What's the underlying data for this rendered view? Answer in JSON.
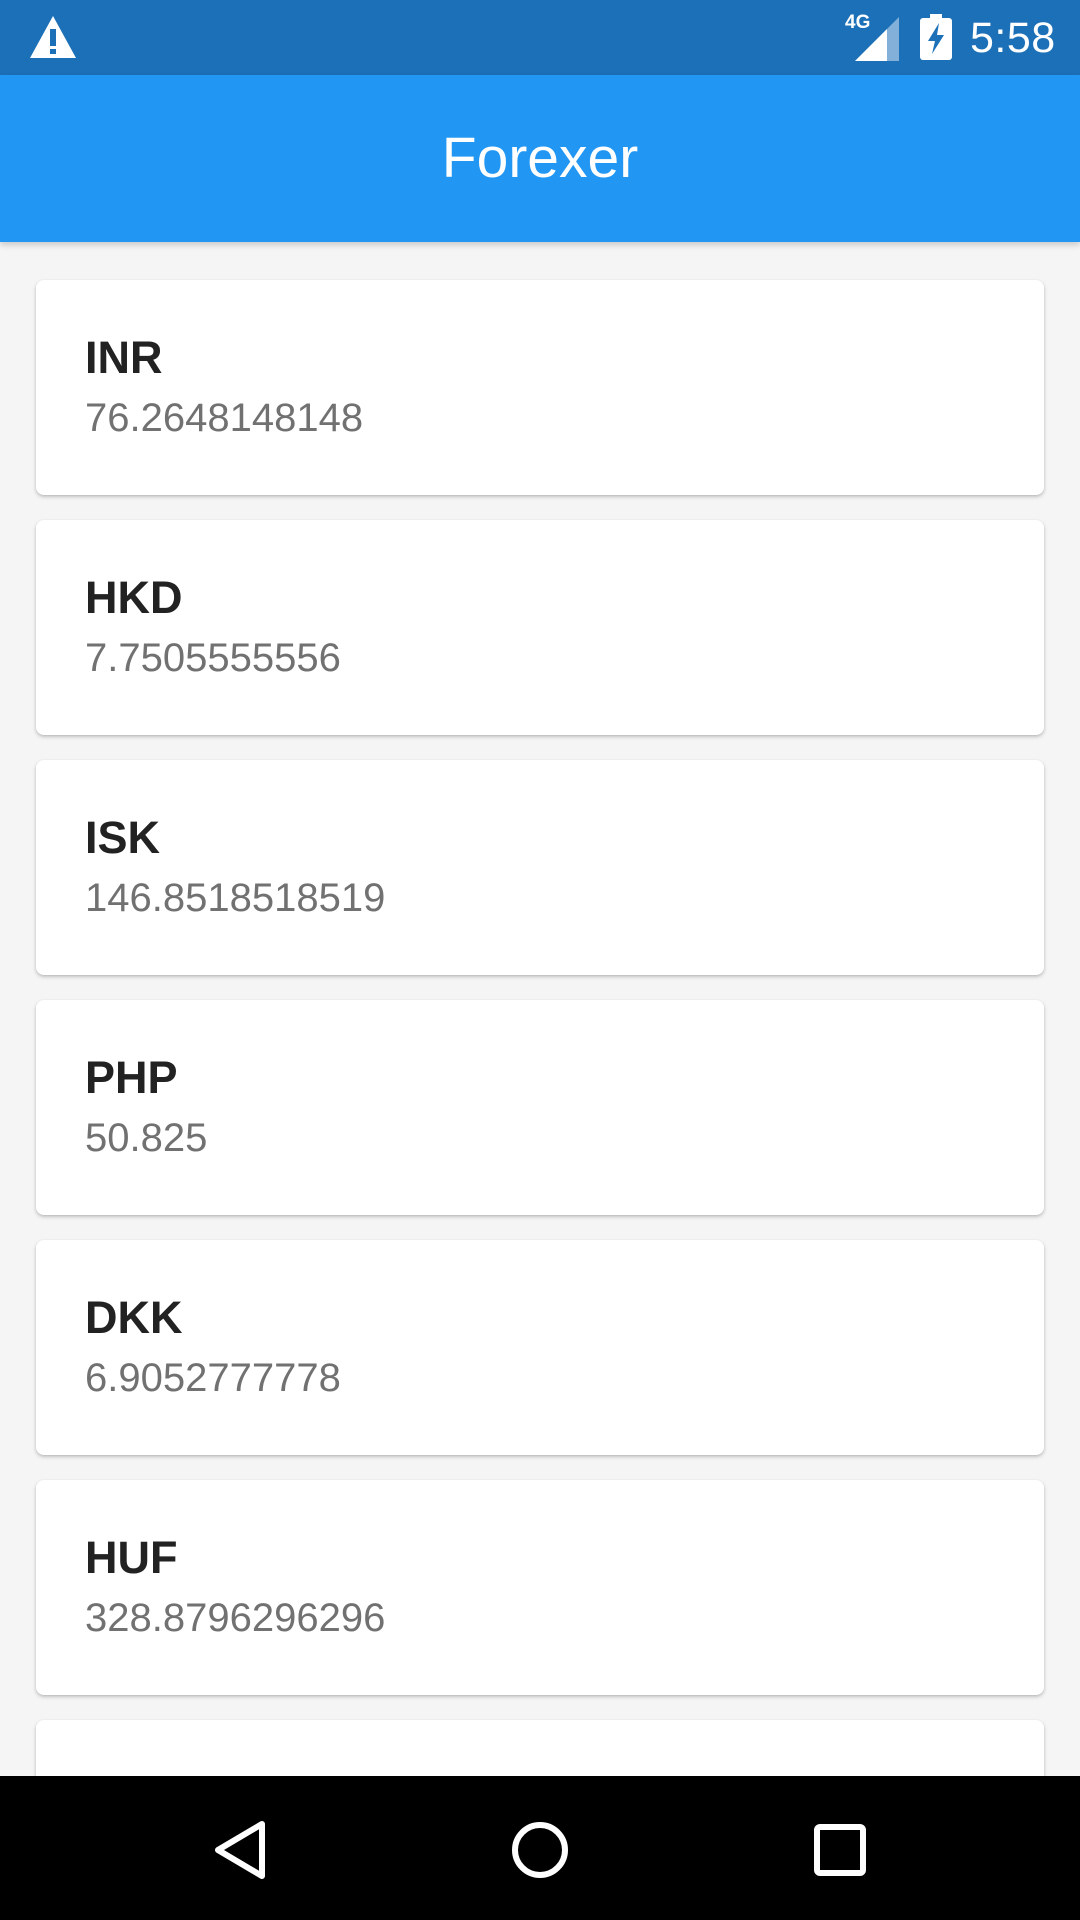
{
  "status_bar": {
    "time": "5:58",
    "network": "4G",
    "icons": [
      "warning-icon",
      "signal-icon",
      "battery-charging-icon"
    ]
  },
  "app_bar": {
    "title": "Forexer"
  },
  "rates": [
    {
      "code": "INR",
      "rate": "76.2648148148"
    },
    {
      "code": "HKD",
      "rate": "7.7505555556"
    },
    {
      "code": "ISK",
      "rate": "146.8518518519"
    },
    {
      "code": "PHP",
      "rate": "50.825"
    },
    {
      "code": "DKK",
      "rate": "6.9052777778"
    },
    {
      "code": "HUF",
      "rate": "328.8796296296"
    }
  ],
  "nav_bar": {
    "icons": [
      "back-icon",
      "home-icon",
      "recents-icon"
    ]
  },
  "colors": {
    "status_bar": "#1c70b8",
    "app_bar": "#2196f3",
    "background": "#f5f5f5",
    "code_text": "#222222",
    "rate_text": "#717171"
  }
}
